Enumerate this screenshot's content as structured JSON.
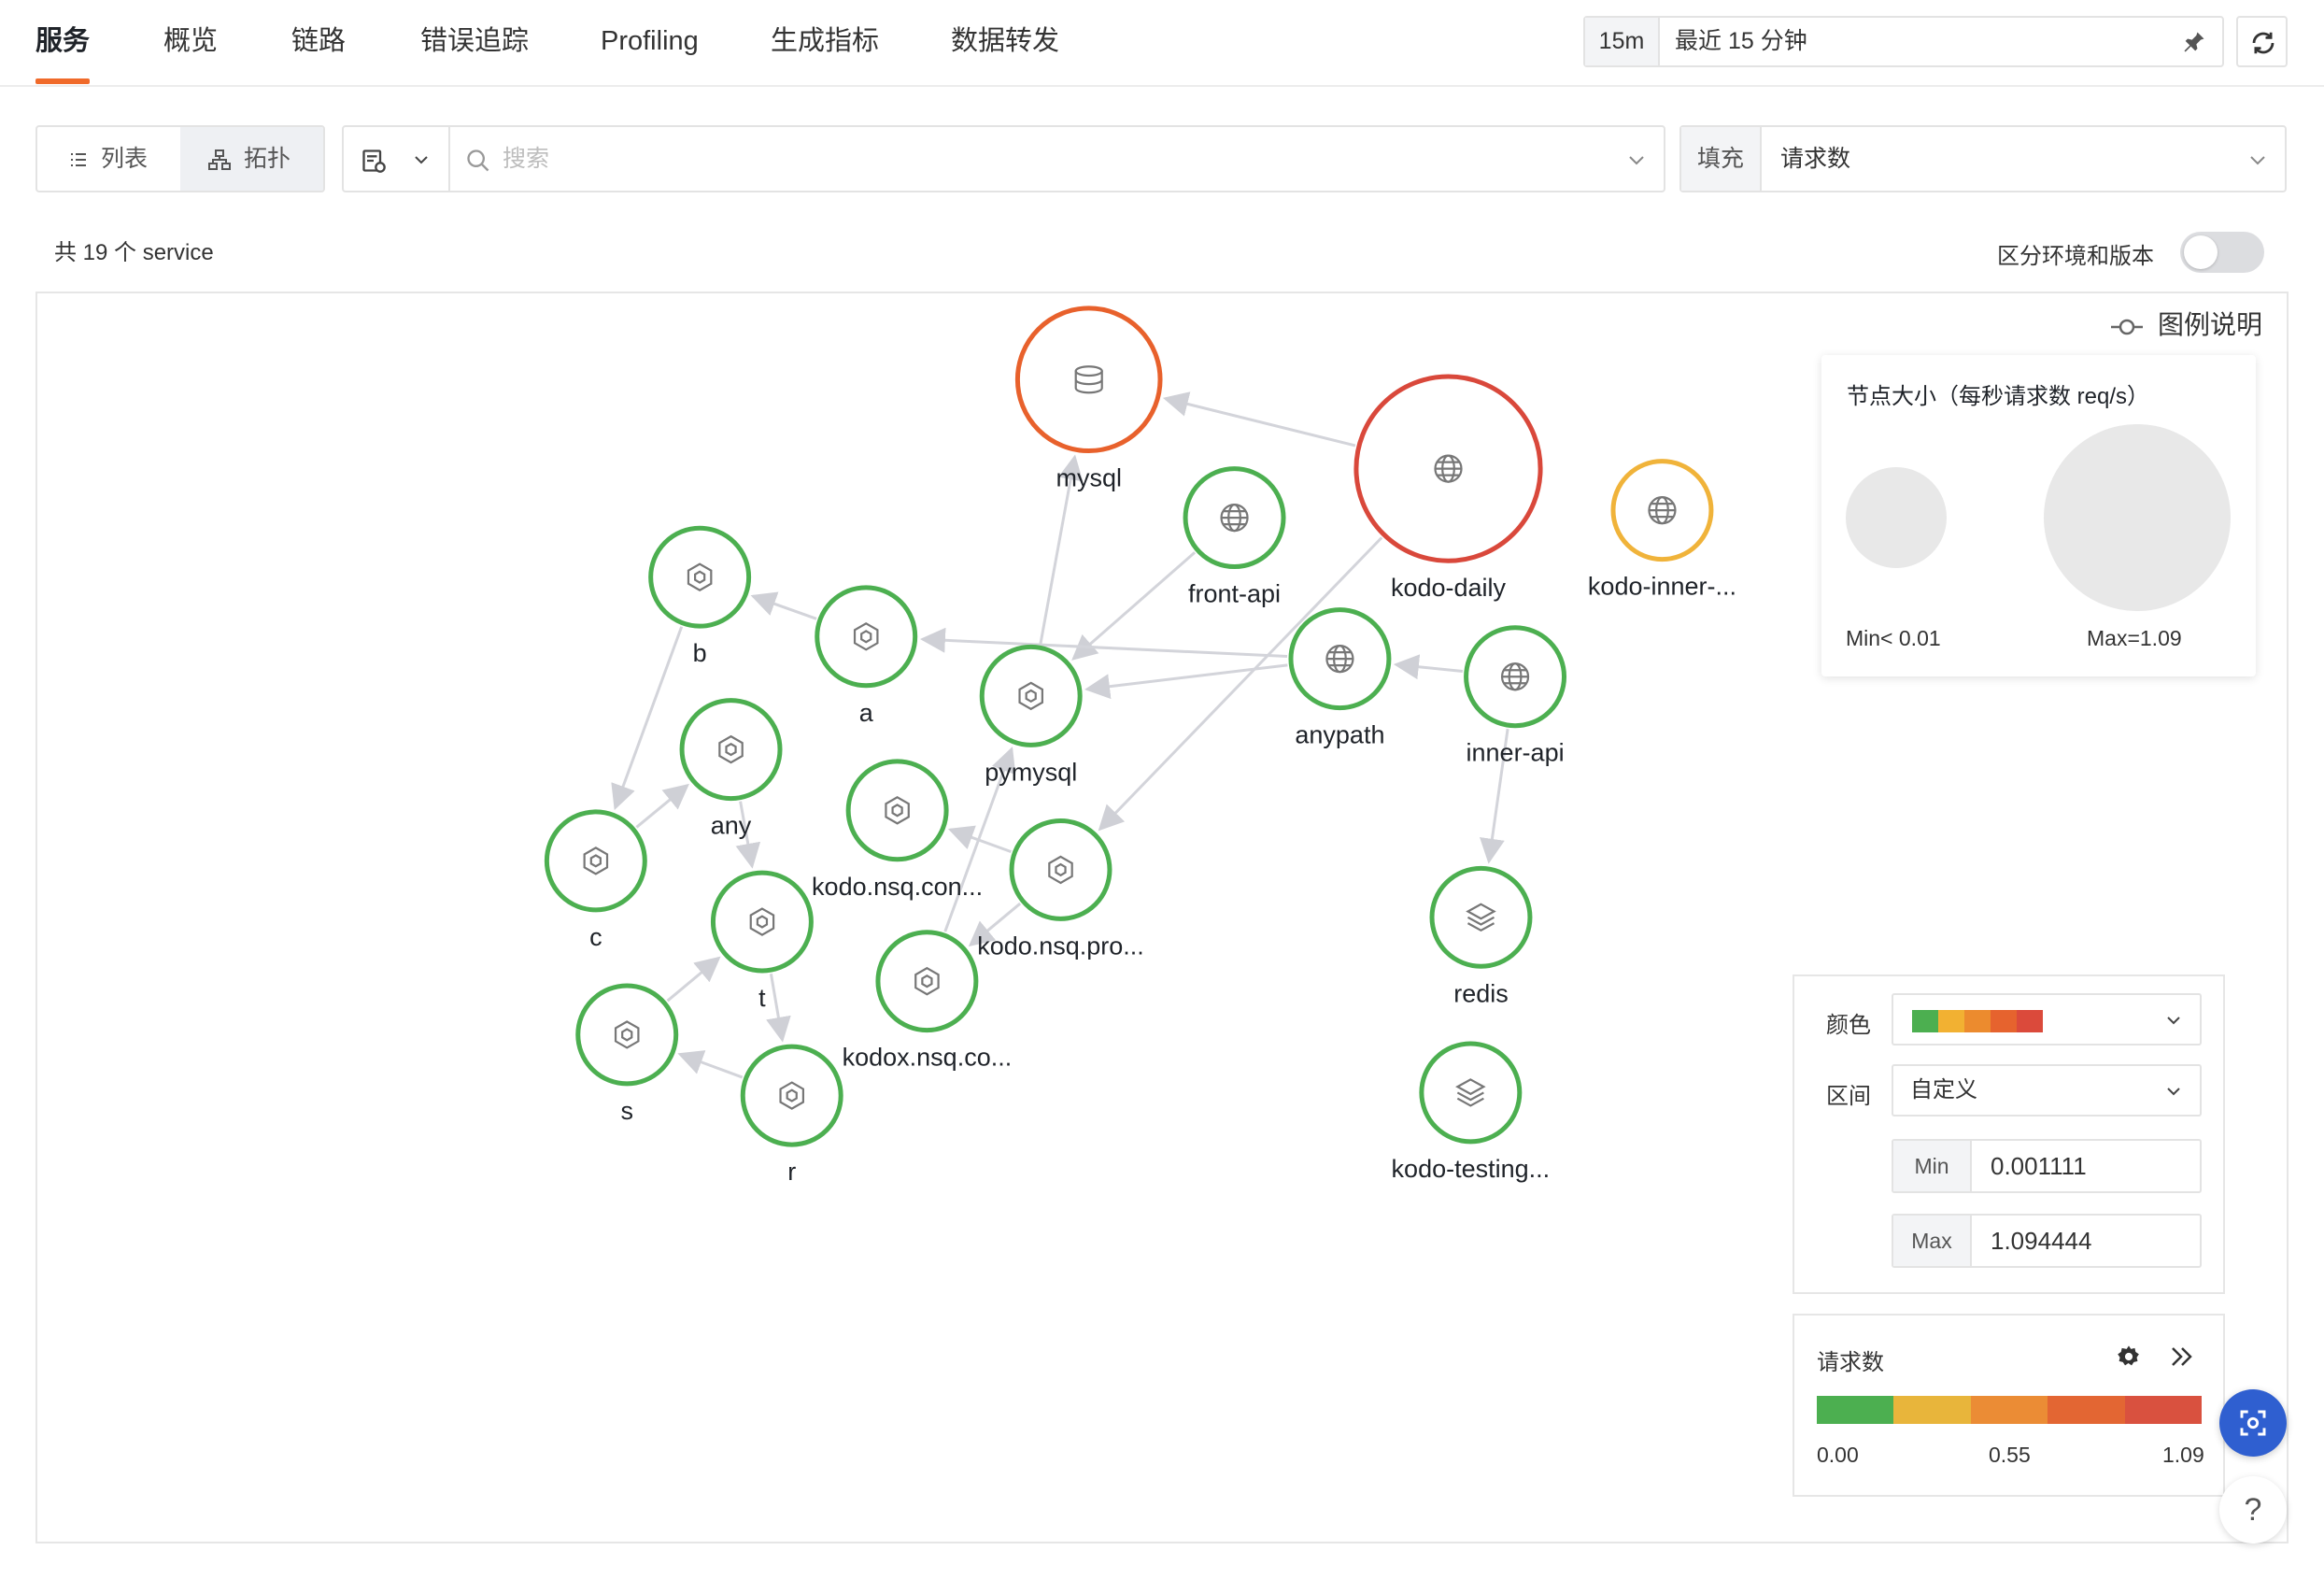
{
  "tabs": [
    {
      "label": "服务",
      "active": true
    },
    {
      "label": "概览"
    },
    {
      "label": "链路"
    },
    {
      "label": "错误追踪"
    },
    {
      "label": "Profiling"
    },
    {
      "label": "生成指标"
    },
    {
      "label": "数据转发"
    }
  ],
  "time": {
    "short": "15m",
    "label": "最近 15 分钟"
  },
  "view_toggle": {
    "list": "列表",
    "topology": "拓扑"
  },
  "search": {
    "placeholder": "搜索"
  },
  "fill": {
    "label": "填充",
    "value": "请求数"
  },
  "service_count": "共 19 个 service",
  "env_toggle": {
    "label": "区分环境和版本",
    "on": false
  },
  "legend_toggle": "图例说明",
  "size_legend": {
    "title": "节点大小（每秒请求数 req/s）",
    "min": "Min< 0.01",
    "max": "Max=1.09"
  },
  "color_panel": {
    "color_label": "颜色",
    "palette": [
      "#4caf50",
      "#f2b132",
      "#ec8b2e",
      "#e6632e",
      "#db4a3b"
    ],
    "range_label": "区间",
    "range_value": "自定义",
    "min_key": "Min",
    "min_value": "0.001111",
    "max_key": "Max",
    "max_value": "1.094444"
  },
  "scale_panel": {
    "title": "请求数",
    "colors": [
      "#4caf50",
      "#e8b53b",
      "#eb8c35",
      "#e36633",
      "#d9513f"
    ],
    "ticks": [
      "0.00",
      "0.55",
      "1.09"
    ]
  },
  "help": "?",
  "nodes": [
    {
      "id": "mysql",
      "label": "mysql",
      "icon": "database",
      "color": "#e8612c"
    },
    {
      "id": "kodo-daily",
      "label": "kodo-daily",
      "icon": "globe",
      "color": "#d9483b"
    },
    {
      "id": "kodo-inner",
      "label": "kodo-inner-...",
      "icon": "globe",
      "color": "#f0b33a"
    },
    {
      "id": "front-api",
      "label": "front-api",
      "icon": "globe",
      "color": "#4caf50"
    },
    {
      "id": "b",
      "label": "b",
      "icon": "hexagon",
      "color": "#4caf50"
    },
    {
      "id": "a",
      "label": "a",
      "icon": "hexagon",
      "color": "#4caf50"
    },
    {
      "id": "pymysql",
      "label": "pymysql",
      "icon": "hexagon",
      "color": "#4caf50"
    },
    {
      "id": "anypath",
      "label": "anypath",
      "icon": "globe",
      "color": "#4caf50"
    },
    {
      "id": "inner-api",
      "label": "inner-api",
      "icon": "globe",
      "color": "#4caf50"
    },
    {
      "id": "any",
      "label": "any",
      "icon": "hexagon",
      "color": "#4caf50"
    },
    {
      "id": "c",
      "label": "c",
      "icon": "hexagon",
      "color": "#4caf50"
    },
    {
      "id": "kodo-nsq-con",
      "label": "kodo.nsq.con...",
      "icon": "hexagon",
      "color": "#4caf50"
    },
    {
      "id": "kodo-nsq-pro",
      "label": "kodo.nsq.pro...",
      "icon": "hexagon",
      "color": "#4caf50"
    },
    {
      "id": "t",
      "label": "t",
      "icon": "hexagon",
      "color": "#4caf50"
    },
    {
      "id": "kodox-nsq-co",
      "label": "kodox.nsq.co...",
      "icon": "hexagon",
      "color": "#4caf50"
    },
    {
      "id": "s",
      "label": "s",
      "icon": "hexagon",
      "color": "#4caf50"
    },
    {
      "id": "r",
      "label": "r",
      "icon": "hexagon",
      "color": "#4caf50"
    },
    {
      "id": "redis",
      "label": "redis",
      "icon": "layers",
      "color": "#4caf50"
    },
    {
      "id": "kodo-testing",
      "label": "kodo-testing...",
      "icon": "layers",
      "color": "#4caf50"
    }
  ],
  "edges": [
    [
      "kodo-daily",
      "mysql"
    ],
    [
      "kodo-daily",
      "kodo-nsq-pro"
    ],
    [
      "pymysql",
      "mysql"
    ],
    [
      "front-api",
      "pymysql"
    ],
    [
      "anypath",
      "a"
    ],
    [
      "anypath",
      "pymysql"
    ],
    [
      "inner-api",
      "anypath"
    ],
    [
      "inner-api",
      "redis"
    ],
    [
      "a",
      "b"
    ],
    [
      "b",
      "c"
    ],
    [
      "c",
      "any"
    ],
    [
      "any",
      "t"
    ],
    [
      "t",
      "r"
    ],
    [
      "r",
      "s"
    ],
    [
      "s",
      "t"
    ],
    [
      "kodo-nsq-pro",
      "kodox-nsq-co"
    ],
    [
      "kodox-nsq-co",
      "pymysql"
    ],
    [
      "kodo-nsq-pro",
      "kodo-nsq-con"
    ]
  ]
}
